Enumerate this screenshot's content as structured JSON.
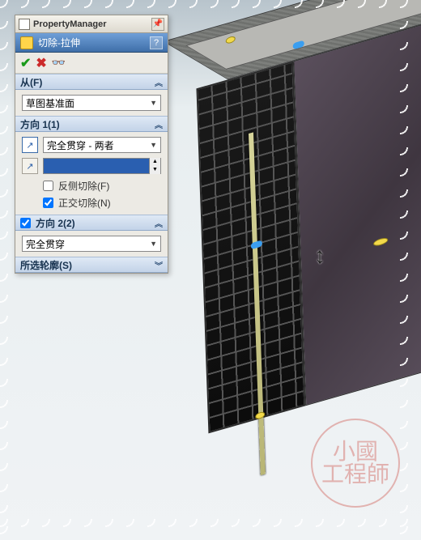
{
  "pm": {
    "title": "PropertyManager"
  },
  "feature": {
    "title": "切除-拉伸",
    "help": "?"
  },
  "from": {
    "head": "从(F)",
    "option": "草图基准面"
  },
  "dir1": {
    "head": "方向 1(1)",
    "end_condition": "完全贯穿 - 两者",
    "value": "",
    "flip_label": "反侧切除(F)",
    "flip_checked": false,
    "normal_label": "正交切除(N)",
    "normal_checked": true
  },
  "dir2": {
    "head": "方向 2(2)",
    "checked": true,
    "end_condition": "完全贯穿"
  },
  "contours": {
    "head": "所选轮廓(S)"
  },
  "watermark": "小國\n工程師"
}
